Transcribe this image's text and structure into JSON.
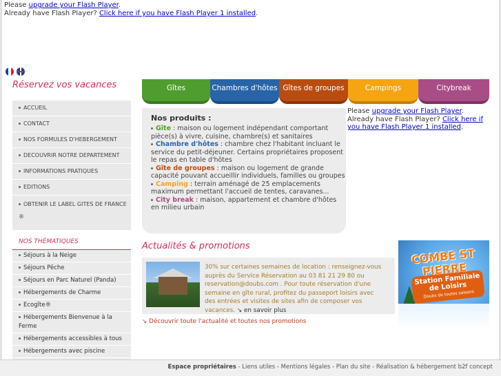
{
  "flash_top": {
    "line1_prefix": "Please ",
    "line1_link": "upgrade your Flash Player",
    "line1_suffix": ".",
    "line2_prefix": "Already have Flash Player? ",
    "line2_link": "Click here if you have Flash Player 1 installed",
    "line2_suffix": "."
  },
  "reservez_title": "Réservez vos vacances",
  "menu": [
    "ACCUEIL",
    "CONTACT",
    "NOS FORMULES D'HEBERGEMENT",
    "DECOUVRIR NOTRE DEPARTEMENT",
    "INFORMATIONS PRATIQUES",
    "EDITIONS",
    "OBTENIR LE LABEL GITES DE FRANCE ®"
  ],
  "thematiques": {
    "title": "NOS THÉMATIQUES",
    "items": [
      "Séjours à la Neige",
      "Séjours Pêche",
      "Séjours en Parc Naturel (Panda)",
      "Hébergements de Charme",
      "Ecogîte®",
      "Hébergements Bienvenue à la Ferme",
      "Hébergements accessibles à tous",
      "Hébergements avec piscine"
    ]
  },
  "tabs": [
    "Gîtes",
    "Chambres d'hôtes",
    "Gîtes de groupes",
    "Campings",
    "Citybreak"
  ],
  "produits": {
    "title": "Nos produits :",
    "items": [
      {
        "name": "Gîte",
        "desc": " : maison ou logement indépendant comportant pièce(s) à vivre, cuisine, chambre(s) et sanitaires",
        "color": "#4f9d2e"
      },
      {
        "name": "Chambre d'hôtes",
        "desc": " : chambre chez l'habitant incluant le service du petit-déjeuner. Certains propriétaires proposent le repas en table d'hôtes",
        "color": "#2a64a8"
      },
      {
        "name": "Gîte de groupes",
        "desc": " : maison ou logement de grande capacité pouvant accueillir individuels, familles ou groupes",
        "color": "#b94d10"
      },
      {
        "name": "Camping",
        "desc": " : terrain aménagé de 25 emplacements maximum permettant l'accueil de tentes, caravanes...",
        "color": "#f5a512"
      },
      {
        "name": "City break",
        "desc": " : maison, appartement et chambre d'hôtes en milieu urbain",
        "color": "#a84d86"
      }
    ]
  },
  "flash_right": {
    "line1_prefix": "Please ",
    "line1_link": "upgrade your Flash Player",
    "line1_suffix": ".",
    "line2_prefix": "Already have Flash Player? ",
    "line2_link": "Click here if you have Flash Player 1 installed",
    "line2_suffix": "."
  },
  "actualites": {
    "title": "Actualités & promotions",
    "text": "30% sur certaines semaines de location : renseignez-vous auprès du Service Réservation au 03 81 21 29 80 ou reservation@doubs.com . Pour toute réservation d'une semaine en gîte rural, profitez du passeport loisirs avec des entrées et visites de sites afin de composer vos vacances.",
    "more": "en savoir plus",
    "decouvrir": "Découvrir toute l'actualité et toutes nos promotions"
  },
  "ad": {
    "title": "COMBE ST PIERRE",
    "sub": "Station Familiale de Loisirs",
    "sub2": "Doubs de toutes saisons"
  },
  "footer": {
    "bold": "Espace propriétaires",
    "rest": " - Liens utiles - Mentions légales - Plan du site - Réalisation & hébergement b2f concept"
  }
}
